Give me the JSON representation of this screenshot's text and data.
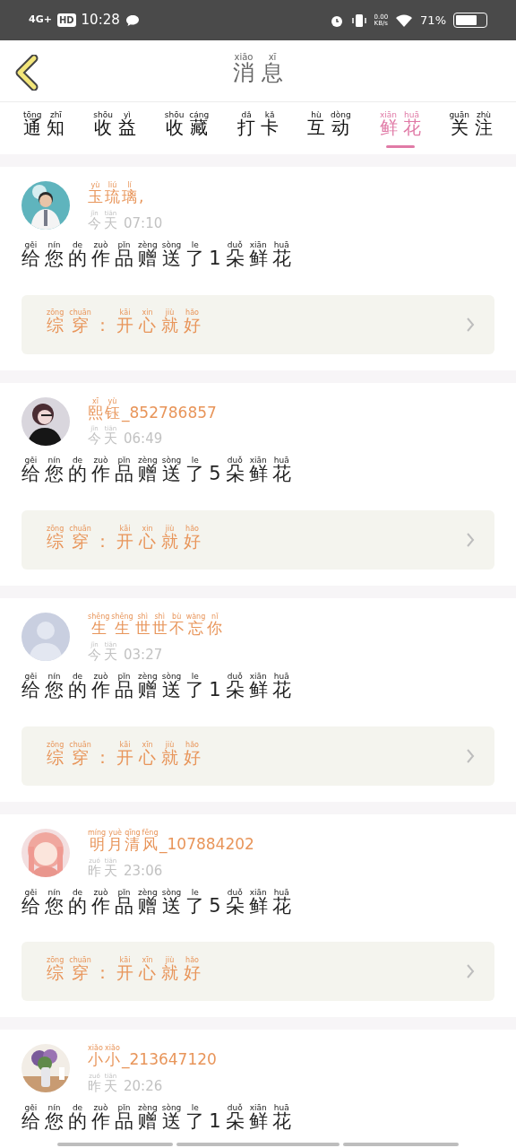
{
  "status_bar": {
    "network": "4G+",
    "hd": "HD",
    "time": "10:28",
    "speed_value": "0.00",
    "speed_unit": "KB/s",
    "battery": "71%"
  },
  "header": {
    "title": [
      {
        "text": "消",
        "pinyin": "xiāo"
      },
      {
        "text": "息",
        "pinyin": "xī"
      }
    ]
  },
  "tabs": [
    {
      "label": [
        {
          "text": "通",
          "pinyin": "tōng"
        },
        {
          "text": "知",
          "pinyin": "zhī"
        }
      ],
      "selected": false
    },
    {
      "label": [
        {
          "text": "收",
          "pinyin": "shōu"
        },
        {
          "text": "益",
          "pinyin": "yì"
        }
      ],
      "selected": false
    },
    {
      "label": [
        {
          "text": "收",
          "pinyin": "shōu"
        },
        {
          "text": "藏",
          "pinyin": "cáng"
        }
      ],
      "selected": false
    },
    {
      "label": [
        {
          "text": "打",
          "pinyin": "dǎ"
        },
        {
          "text": "卡",
          "pinyin": "kǎ"
        }
      ],
      "selected": false
    },
    {
      "label": [
        {
          "text": "互",
          "pinyin": "hù"
        },
        {
          "text": "动",
          "pinyin": "dòng"
        }
      ],
      "selected": false
    },
    {
      "label": [
        {
          "text": "鲜",
          "pinyin": "xiān"
        },
        {
          "text": "花",
          "pinyin": "huā"
        }
      ],
      "selected": true
    },
    {
      "label": [
        {
          "text": "关",
          "pinyin": "guān"
        },
        {
          "text": "注",
          "pinyin": "zhù"
        }
      ],
      "selected": false
    }
  ],
  "messages": [
    {
      "avatar": {
        "kind": "picture"
      },
      "name": [
        {
          "text": "玉",
          "pinyin": "yù"
        },
        {
          "text": "琉",
          "pinyin": "liú"
        },
        {
          "text": "璃",
          "pinyin": "lí"
        },
        {
          "text": ","
        }
      ],
      "day": [
        {
          "text": "今",
          "pinyin": "jīn"
        },
        {
          "text": "天",
          "pinyin": "tiān"
        }
      ],
      "time": "07:10",
      "body": [
        {
          "text": "给",
          "pinyin": "gěi"
        },
        {
          "text": "您",
          "pinyin": "nín"
        },
        {
          "text": "的",
          "pinyin": "de"
        },
        {
          "text": "作",
          "pinyin": "zuò"
        },
        {
          "text": "品",
          "pinyin": "pǐn"
        },
        {
          "text": "赠",
          "pinyin": "zèng"
        },
        {
          "text": "送",
          "pinyin": "sòng"
        },
        {
          "text": "了",
          "pinyin": "le"
        },
        {
          "text": "1"
        },
        {
          "text": "朵",
          "pinyin": "duǒ"
        },
        {
          "text": "鲜",
          "pinyin": "xiān"
        },
        {
          "text": "花",
          "pinyin": "huā"
        }
      ],
      "work": [
        {
          "text": "综",
          "pinyin": "zōng"
        },
        {
          "text": "穿",
          "pinyin": "chuān"
        },
        {
          "text": "："
        },
        {
          "text": "开",
          "pinyin": "kāi"
        },
        {
          "text": "心",
          "pinyin": "xin"
        },
        {
          "text": "就",
          "pinyin": "jiù"
        },
        {
          "text": "好",
          "pinyin": "hǎo"
        }
      ]
    },
    {
      "avatar": {
        "kind": "picture"
      },
      "name": [
        {
          "text": "熙",
          "pinyin": "xī"
        },
        {
          "text": "钰",
          "pinyin": "yù"
        },
        {
          "text": "_852786857"
        }
      ],
      "day": [
        {
          "text": "今",
          "pinyin": "jīn"
        },
        {
          "text": "天",
          "pinyin": "tiān"
        }
      ],
      "time": "06:49",
      "body": [
        {
          "text": "给",
          "pinyin": "gěi"
        },
        {
          "text": "您",
          "pinyin": "nín"
        },
        {
          "text": "的",
          "pinyin": "de"
        },
        {
          "text": "作",
          "pinyin": "zuò"
        },
        {
          "text": "品",
          "pinyin": "pǐn"
        },
        {
          "text": "赠",
          "pinyin": "zèng"
        },
        {
          "text": "送",
          "pinyin": "sòng"
        },
        {
          "text": "了",
          "pinyin": "le"
        },
        {
          "text": "5"
        },
        {
          "text": "朵",
          "pinyin": "duǒ"
        },
        {
          "text": "鲜",
          "pinyin": "xiān"
        },
        {
          "text": "花",
          "pinyin": "huā"
        }
      ],
      "work": [
        {
          "text": "综",
          "pinyin": "zōng"
        },
        {
          "text": "穿",
          "pinyin": "chuān"
        },
        {
          "text": "："
        },
        {
          "text": "开",
          "pinyin": "kāi"
        },
        {
          "text": "心",
          "pinyin": "xin"
        },
        {
          "text": "就",
          "pinyin": "jiù"
        },
        {
          "text": "好",
          "pinyin": "hǎo"
        }
      ]
    },
    {
      "avatar": {
        "kind": "default"
      },
      "name": [
        {
          "text": "生",
          "pinyin": "shēng"
        },
        {
          "text": "生",
          "pinyin": "shēng"
        },
        {
          "text": "世",
          "pinyin": "shì"
        },
        {
          "text": "世",
          "pinyin": "shì"
        },
        {
          "text": "不",
          "pinyin": "bù"
        },
        {
          "text": "忘",
          "pinyin": "wàng"
        },
        {
          "text": "你",
          "pinyin": "nǐ"
        }
      ],
      "day": [
        {
          "text": "今",
          "pinyin": "jīn"
        },
        {
          "text": "天",
          "pinyin": "tiān"
        }
      ],
      "time": "03:27",
      "body": [
        {
          "text": "给",
          "pinyin": "gěi"
        },
        {
          "text": "您",
          "pinyin": "nín"
        },
        {
          "text": "的",
          "pinyin": "de"
        },
        {
          "text": "作",
          "pinyin": "zuò"
        },
        {
          "text": "品",
          "pinyin": "pǐn"
        },
        {
          "text": "赠",
          "pinyin": "zèng"
        },
        {
          "text": "送",
          "pinyin": "sòng"
        },
        {
          "text": "了",
          "pinyin": "le"
        },
        {
          "text": "1"
        },
        {
          "text": "朵",
          "pinyin": "duǒ"
        },
        {
          "text": "鲜",
          "pinyin": "xiān"
        },
        {
          "text": "花",
          "pinyin": "huā"
        }
      ],
      "work": [
        {
          "text": "综",
          "pinyin": "zōng"
        },
        {
          "text": "穿",
          "pinyin": "chuān"
        },
        {
          "text": "："
        },
        {
          "text": "开",
          "pinyin": "kāi"
        },
        {
          "text": "心",
          "pinyin": "xīn"
        },
        {
          "text": "就",
          "pinyin": "jiù"
        },
        {
          "text": "好",
          "pinyin": "hǎo"
        }
      ]
    },
    {
      "avatar": {
        "kind": "picture"
      },
      "name": [
        {
          "text": "明",
          "pinyin": "míng"
        },
        {
          "text": "月",
          "pinyin": "yuè"
        },
        {
          "text": "清",
          "pinyin": "qīng"
        },
        {
          "text": "风",
          "pinyin": "fēng"
        },
        {
          "text": "_107884202"
        }
      ],
      "day": [
        {
          "text": "昨",
          "pinyin": "zuó"
        },
        {
          "text": "天",
          "pinyin": "tiān"
        }
      ],
      "time": "23:06",
      "body": [
        {
          "text": "给",
          "pinyin": "gěi"
        },
        {
          "text": "您",
          "pinyin": "nín"
        },
        {
          "text": "的",
          "pinyin": "de"
        },
        {
          "text": "作",
          "pinyin": "zuò"
        },
        {
          "text": "品",
          "pinyin": "pǐn"
        },
        {
          "text": "赠",
          "pinyin": "zèng"
        },
        {
          "text": "送",
          "pinyin": "sòng"
        },
        {
          "text": "了",
          "pinyin": "le"
        },
        {
          "text": "5"
        },
        {
          "text": "朵",
          "pinyin": "duǒ"
        },
        {
          "text": "鲜",
          "pinyin": "xiān"
        },
        {
          "text": "花",
          "pinyin": "huā"
        }
      ],
      "work": [
        {
          "text": "综",
          "pinyin": "zōng"
        },
        {
          "text": "穿",
          "pinyin": "chuān"
        },
        {
          "text": "："
        },
        {
          "text": "开",
          "pinyin": "kāi"
        },
        {
          "text": "心",
          "pinyin": "xīn"
        },
        {
          "text": "就",
          "pinyin": "jiù"
        },
        {
          "text": "好",
          "pinyin": "hǎo"
        }
      ]
    },
    {
      "avatar": {
        "kind": "picture"
      },
      "name": [
        {
          "text": "小",
          "pinyin": "xiǎo"
        },
        {
          "text": "小",
          "pinyin": "xiǎo"
        },
        {
          "text": "_213647120"
        }
      ],
      "day": [
        {
          "text": "昨",
          "pinyin": "zuó"
        },
        {
          "text": "天",
          "pinyin": "tiān"
        }
      ],
      "time": "20:26",
      "body": [
        {
          "text": "给",
          "pinyin": "gěi"
        },
        {
          "text": "您",
          "pinyin": "nín"
        },
        {
          "text": "的",
          "pinyin": "de"
        },
        {
          "text": "作",
          "pinyin": "zuò"
        },
        {
          "text": "品",
          "pinyin": "pǐn"
        },
        {
          "text": "赠",
          "pinyin": "zèng"
        },
        {
          "text": "送",
          "pinyin": "sòng"
        },
        {
          "text": "了",
          "pinyin": "le"
        },
        {
          "text": "1"
        },
        {
          "text": "朵",
          "pinyin": "duǒ"
        },
        {
          "text": "鲜",
          "pinyin": "xiān"
        },
        {
          "text": "花",
          "pinyin": "huā"
        }
      ]
    }
  ]
}
